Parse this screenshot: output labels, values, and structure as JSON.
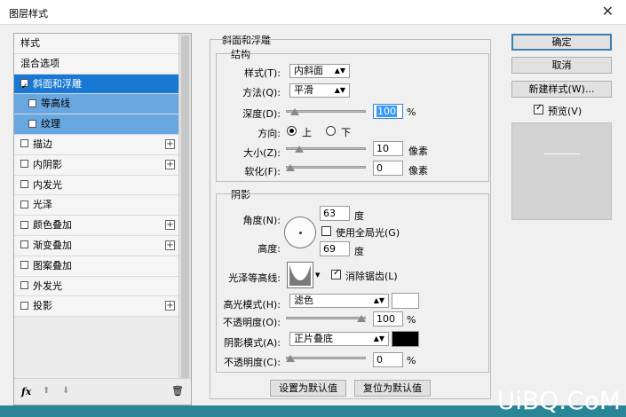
{
  "window": {
    "title": "图层样式",
    "close": "✕"
  },
  "left_panel": {
    "items": [
      {
        "label": "样式",
        "checkbox": false,
        "checked": false,
        "plus": false,
        "state": "normal"
      },
      {
        "label": "混合选项",
        "checkbox": false,
        "checked": false,
        "plus": false,
        "state": "normal"
      },
      {
        "label": "斜面和浮雕",
        "checkbox": true,
        "checked": true,
        "plus": false,
        "state": "active"
      },
      {
        "label": "等高线",
        "checkbox": true,
        "checked": false,
        "plus": false,
        "state": "sub"
      },
      {
        "label": "纹理",
        "checkbox": true,
        "checked": false,
        "plus": false,
        "state": "sub"
      },
      {
        "label": "描边",
        "checkbox": true,
        "checked": false,
        "plus": true,
        "state": "normal"
      },
      {
        "label": "内阴影",
        "checkbox": true,
        "checked": false,
        "plus": true,
        "state": "normal"
      },
      {
        "label": "内发光",
        "checkbox": true,
        "checked": false,
        "plus": false,
        "state": "normal"
      },
      {
        "label": "光泽",
        "checkbox": true,
        "checked": false,
        "plus": false,
        "state": "normal"
      },
      {
        "label": "颜色叠加",
        "checkbox": true,
        "checked": false,
        "plus": true,
        "state": "normal"
      },
      {
        "label": "渐变叠加",
        "checkbox": true,
        "checked": false,
        "plus": true,
        "state": "normal"
      },
      {
        "label": "图案叠加",
        "checkbox": true,
        "checked": false,
        "plus": false,
        "state": "normal"
      },
      {
        "label": "外发光",
        "checkbox": true,
        "checked": false,
        "plus": false,
        "state": "normal"
      },
      {
        "label": "投影",
        "checkbox": true,
        "checked": false,
        "plus": true,
        "state": "normal"
      }
    ],
    "footer": {
      "fx": "fx",
      "up": "⬆",
      "down": "⬇",
      "trash": "🗑"
    }
  },
  "bevel": {
    "group_title": "斜面和浮雕",
    "structure_title": "结构",
    "style_label": "样式(T):",
    "style_value": "内斜面",
    "technique_label": "方法(Q):",
    "technique_value": "平滑",
    "depth_label": "深度(D):",
    "depth_value": "100",
    "depth_unit": "%",
    "depth_slider": 0.06,
    "direction_label": "方向:",
    "direction_up": "上",
    "direction_down": "下",
    "size_label": "大小(Z):",
    "size_value": "10",
    "size_unit": "像素",
    "size_slider": 0.12,
    "soften_label": "软化(F):",
    "soften_value": "0",
    "soften_unit": "像素",
    "soften_slider": 0.0
  },
  "shading": {
    "title": "阴影",
    "angle_label": "角度(N):",
    "angle_value": "63",
    "angle_unit": "度",
    "global_light_label": "使用全局光(G)",
    "altitude_label": "高度:",
    "altitude_value": "69",
    "altitude_unit": "度",
    "gloss_label": "光泽等高线:",
    "antialias_label": "消除锯齿(L)",
    "highlight_label": "高光模式(H):",
    "highlight_value": "滤色",
    "highlight_color": "#ffffff",
    "highlight_opacity_label": "不透明度(O):",
    "highlight_opacity_value": "100",
    "highlight_opacity_unit": "%",
    "highlight_opacity_slider": 1.0,
    "shadow_label": "阴影模式(A):",
    "shadow_value": "正片叠底",
    "shadow_color": "#000000",
    "shadow_opacity_label": "不透明度(C):",
    "shadow_opacity_value": "0",
    "shadow_opacity_unit": "%",
    "shadow_opacity_slider": 0.0
  },
  "bottom_buttons": {
    "set_default": "设置为默认值",
    "reset_default": "复位为默认值"
  },
  "right_panel": {
    "ok": "确定",
    "cancel": "取消",
    "new_style": "新建样式(W)...",
    "preview_label": "预览(V)"
  },
  "watermark": "UiBQ.CoM"
}
